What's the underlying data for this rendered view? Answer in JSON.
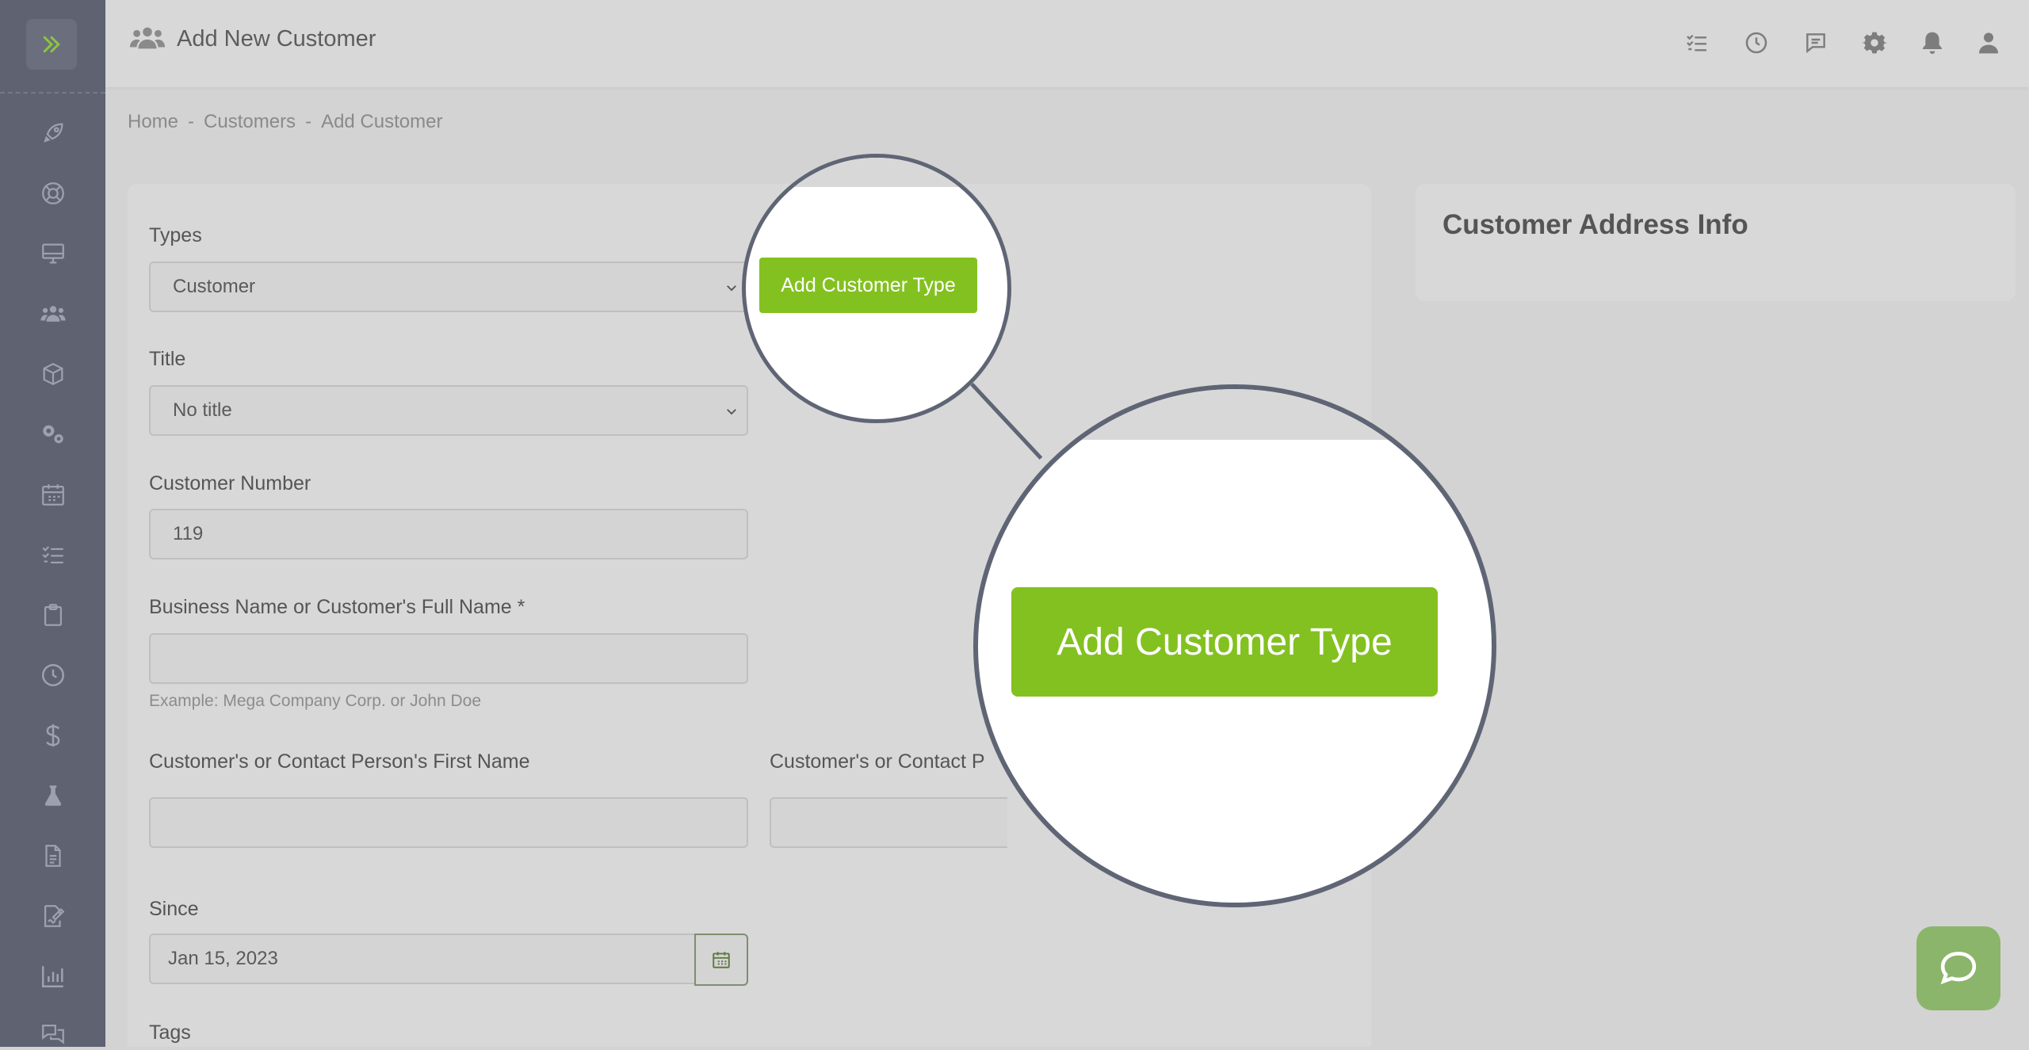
{
  "header": {
    "title": "Add New Customer",
    "icons": [
      "tasks-icon",
      "clock-icon",
      "message-icon",
      "gear-icon",
      "bell-icon",
      "user-icon"
    ]
  },
  "breadcrumb": {
    "home": "Home",
    "customers": "Customers",
    "current": "Add Customer",
    "separator": "-"
  },
  "sidebar": {
    "icons": [
      "rocket-icon",
      "lifebuoy-icon",
      "monitor-icon",
      "users-icon",
      "box-icon",
      "gears-icon",
      "calendar-icon",
      "checklist-icon",
      "clipboard-icon",
      "clock-icon",
      "dollar-icon",
      "flask-icon",
      "document-icon",
      "signature-icon",
      "chart-icon",
      "chat-icon"
    ]
  },
  "form": {
    "types_label": "Types",
    "types_value": "Customer",
    "add_type_button": "Add Customer Type",
    "title_label": "Title",
    "title_value": "No title",
    "number_label": "Customer Number",
    "number_value": "119",
    "business_label": "Business Name or Customer's Full Name *",
    "business_value": "",
    "business_hint": "Example: Mega Company Corp. or John Doe",
    "first_name_label": "Customer's or Contact Person's First Name",
    "last_name_label": "Customer's or Contact P",
    "since_label": "Since",
    "since_value": "Jan 15, 2023",
    "tags_label": "Tags"
  },
  "address": {
    "title": "Customer Address Info"
  },
  "colors": {
    "accent_green": "#83c120",
    "sidebar": "#5e6271",
    "chat": "#8bb56a"
  }
}
